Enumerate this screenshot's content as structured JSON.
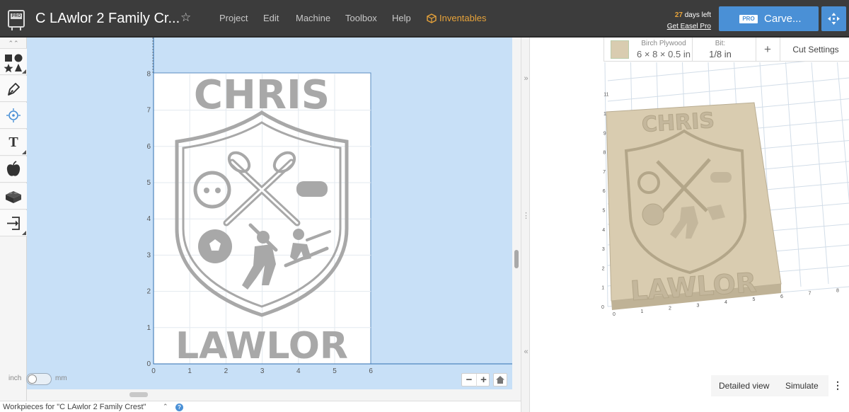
{
  "header": {
    "logo_badge": "PRO",
    "project_title": "C LAwlor 2 Family Cr...",
    "star_glyph": "☆",
    "menus": [
      "Project",
      "Edit",
      "Machine",
      "Toolbox",
      "Help"
    ],
    "inventables_label": "Inventables",
    "trial_days": "27",
    "trial_suffix": " days left",
    "get_pro_label": "Get Easel Pro",
    "carve_pro_badge": "PRO",
    "carve_label": "Carve..."
  },
  "sidebar": {
    "collapse_glyph": "«",
    "tools": [
      "shapes-icon",
      "pen-icon",
      "target-icon",
      "text-icon",
      "apple-icon",
      "lego-icon",
      "import-icon"
    ],
    "text_tool_glyph": "T"
  },
  "canvas": {
    "y_ticks": [
      "0",
      "1",
      "2",
      "3",
      "4",
      "5",
      "6",
      "7",
      "8"
    ],
    "x_ticks": [
      "0",
      "1",
      "2",
      "3",
      "4",
      "5",
      "6"
    ],
    "design_top_text": "CHRIS",
    "design_bottom_text": "LAWLOR",
    "unit_left": "inch",
    "unit_right": "mm",
    "zoom_out_glyph": "−",
    "zoom_in_glyph": "+"
  },
  "divider": {
    "expand_glyph": "»",
    "collapse_glyph": "«",
    "handle_glyph": "⋮"
  },
  "preview": {
    "material_name": "Birch Plywood",
    "material_size": "6 × 8 × 0.5 in",
    "bit_label": "Bit:",
    "bit_value": "1/8 in",
    "add_glyph": "+",
    "cut_settings_label": "Cut Settings",
    "axis_y_ticks": [
      "0",
      "1",
      "2",
      "3",
      "4",
      "5",
      "6",
      "7",
      "8",
      "9",
      "10",
      "11"
    ],
    "axis_x_ticks": [
      "0",
      "1",
      "2",
      "3",
      "4",
      "5",
      "6",
      "7",
      "8"
    ],
    "preview_top_text": "CHRIS",
    "preview_bottom_text": "LAWLOR",
    "detailed_view_label": "Detailed view",
    "simulate_label": "Simulate",
    "more_glyph": "⋮",
    "material_color": "#d9ccb0"
  },
  "footer": {
    "title": "Workpieces for \"C LAwlor 2 Family Crest\"",
    "chevron": "⌃",
    "help_glyph": "?"
  },
  "colors": {
    "topbar": "#3c3c3c",
    "accent": "#4a90d6",
    "inventables": "#e7a33a",
    "canvas_bg": "#c8e0f7",
    "design_gray": "#a8a8a8"
  }
}
